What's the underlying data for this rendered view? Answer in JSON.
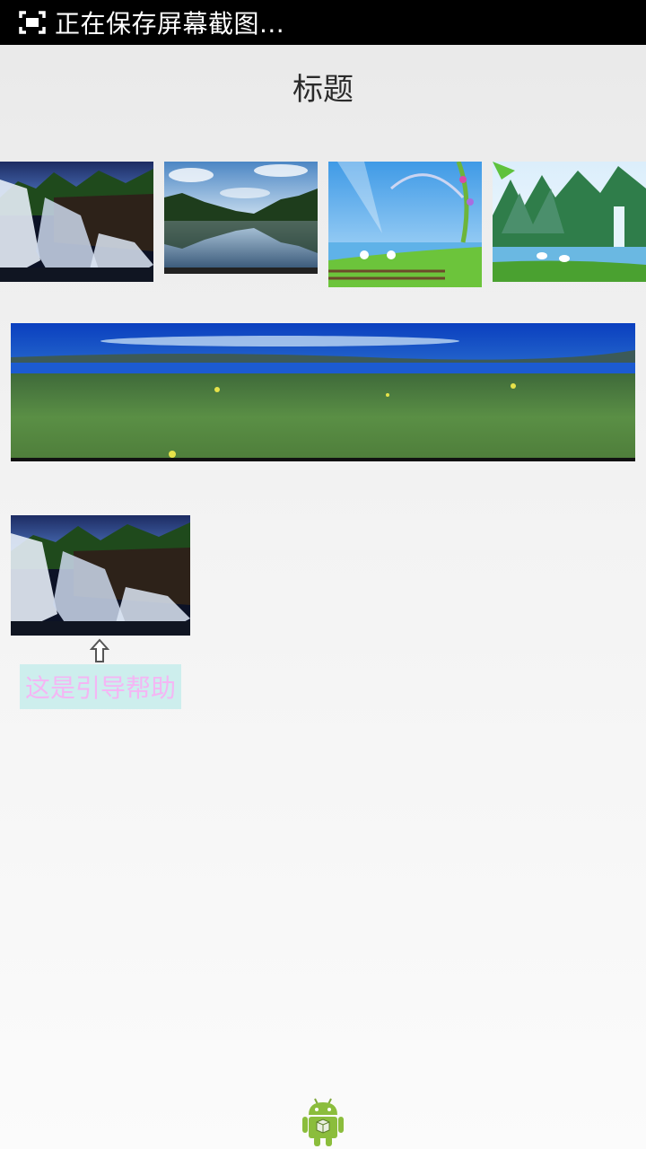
{
  "status_bar": {
    "text": "正在保存屏幕截图...",
    "icon": "screenshot-icon"
  },
  "header": {
    "title": "标题"
  },
  "gallery": {
    "thumbnails": [
      {
        "name": "waterfall-image"
      },
      {
        "name": "lake-reflection-image"
      },
      {
        "name": "seaside-swans-image"
      },
      {
        "name": "mountain-cranes-image"
      }
    ]
  },
  "banner": {
    "name": "grassland-lake-banner"
  },
  "guide": {
    "image": "waterfall-image",
    "arrow_icon": "up-arrow-icon",
    "text": "这是引导帮助",
    "colors": {
      "background": "#cdeeed",
      "text": "#f4b6f4"
    }
  },
  "footer": {
    "icon": "android-robot-icon"
  }
}
